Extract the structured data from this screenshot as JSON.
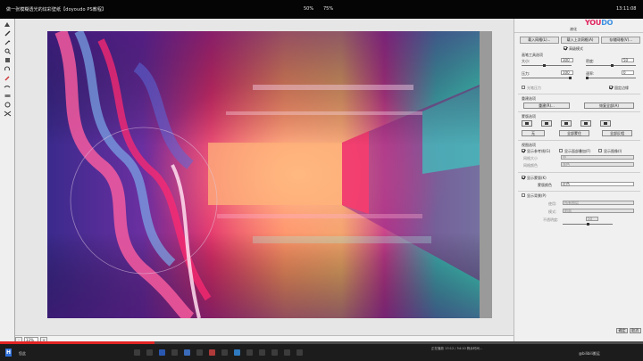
{
  "window": {
    "title": "做一张模糊透光的炫彩壁纸【doyoudo PS教程】",
    "zoom_a": "50%",
    "zoom_b": "75%",
    "time": "13:11:08"
  },
  "toolbox": {
    "tools": [
      "move-tool-icon",
      "brush-tool-icon",
      "pen-tool-icon",
      "zoom-tool-icon",
      "hand-tool-icon",
      "rotate-tool-icon",
      "eyedropper-tool-icon",
      "smudge-tool-icon",
      "eraser-tool-icon",
      "twirl-tool-icon",
      "pucker-tool-icon"
    ]
  },
  "canvas": {
    "zoom_value": "33%",
    "zoom_minus": "-",
    "zoom_plus": "+"
  },
  "panel": {
    "logo_a": "YOU",
    "logo_b": "DO",
    "header": "液化",
    "tabs": [
      "载入网格(L)...",
      "载入上次网格(A)",
      "存储网格(V)..."
    ],
    "advanced_mode": "高级模式",
    "brush_options_title": "画笔工具选项",
    "size_label": "大小:",
    "size_value": "300",
    "pressure_label": "压力:",
    "pressure_value": "100",
    "density_label": "密度:",
    "density_value": "50",
    "rate_label": "速率:",
    "rate_value": "0",
    "stylus_label": "光笔压力",
    "pin_edges_label": "固定边缘",
    "reconstruct_title": "重建选项",
    "reconstruct_button": "重建(R)...",
    "restore_all_button": "恢复全部(A)",
    "mask_title": "蒙版选项",
    "mask_none": "无",
    "mask_all": "全部蒙住",
    "mask_invert": "全部反相",
    "view_title": "视图选项",
    "show_guides": "显示参考线(G)",
    "show_face": "显示面部叠加(F)",
    "show_image": "显示图像(I)",
    "show_mesh": "显示网格(E)",
    "mesh_size_label": "网格大小",
    "mesh_size_value": "中",
    "mesh_color_label": "网格颜色",
    "mesh_color_value": "灰色",
    "show_mask": "显示蒙版(K)",
    "mask_color_label": "蒙版颜色",
    "mask_color_value": "红色",
    "show_backdrop": "显示背景(P)",
    "use_label": "使用:",
    "use_value": "所有图层",
    "mode_label": "模式:",
    "mode_value": "前面",
    "opacity_label": "不透明度:",
    "opacity_value": "50",
    "nav_ok": "确定",
    "nav_cancel": "取消"
  },
  "taskbar": {
    "start": "H",
    "label": "您此",
    "status": "正在播放 13:12 / 54:10 剩余时间...",
    "clock": "@bilibili搬运"
  },
  "progress": {
    "fraction": 0.24
  }
}
